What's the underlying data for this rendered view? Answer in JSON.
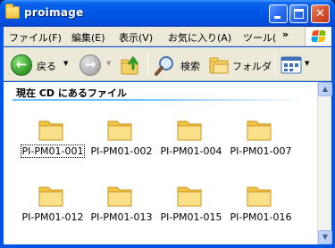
{
  "window": {
    "title": "proimage"
  },
  "menu": {
    "items": [
      {
        "label": "ファイル(F)"
      },
      {
        "label": "編集(E)"
      },
      {
        "label": "表示(V)"
      },
      {
        "label": "お気に入り(A)"
      },
      {
        "label": "ツール("
      }
    ],
    "more": "»"
  },
  "toolbar": {
    "back_label": "戻る",
    "search_label": "検索",
    "folders_label": "フォルダ"
  },
  "content": {
    "group_title": "現在 CD にあるファイル",
    "files": [
      {
        "name": "PI-PM01-001"
      },
      {
        "name": "PI-PM01-002"
      },
      {
        "name": "PI-PM01-004"
      },
      {
        "name": "PI-PM01-007"
      },
      {
        "name": "PI-PM01-012"
      },
      {
        "name": "PI-PM01-013"
      },
      {
        "name": "PI-PM01-015"
      },
      {
        "name": "PI-PM01-016"
      }
    ]
  },
  "colors": {
    "titlebar": "#0058e6",
    "folder": "#f4d164",
    "group_line": "#70bfff"
  }
}
